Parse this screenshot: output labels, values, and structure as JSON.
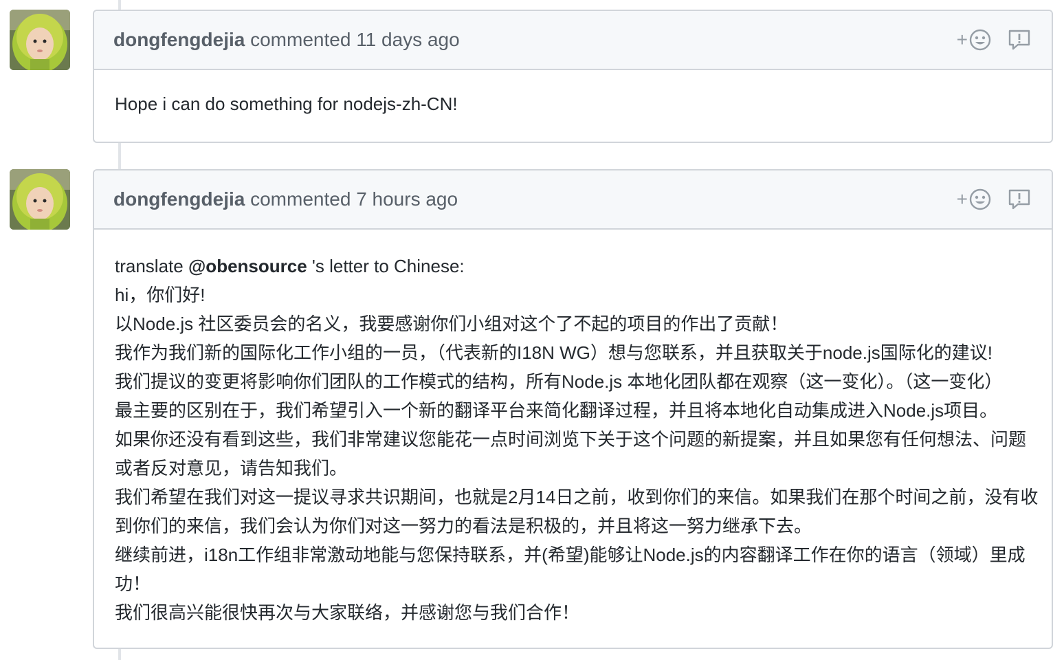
{
  "comments": [
    {
      "author": "dongfengdejia",
      "action": "commented",
      "timestamp": "11 days ago",
      "reaction_icon": "smiley-icon",
      "report_icon": "report-icon",
      "body_lines": [
        "Hope i can do something for nodejs-zh-CN!"
      ]
    },
    {
      "author": "dongfengdejia",
      "action": "commented",
      "timestamp": "7 hours ago",
      "reaction_icon": "smiley-icon",
      "report_icon": "report-icon",
      "first_line": {
        "prefix": "translate ",
        "mention": "@obensource",
        "suffix": " 's letter to Chinese:"
      },
      "body_lines": [
        "hi，你们好!",
        "以Node.js 社区委员会的名义，我要感谢你们小组对这个了不起的项目的作出了贡献！",
        "我作为我们新的国际化工作小组的一员，（代表新的I18N WG）想与您联系，并且获取关于node.js国际化的建议!",
        "我们提议的变更将影响你们团队的工作模式的结构，所有Node.js 本地化团队都在观察（这一变化）。（这一变化）",
        "最主要的区别在于，我们希望引入一个新的翻译平台来简化翻译过程，并且将本地化自动集成进入Node.js项目。",
        "如果你还没有看到这些，我们非常建议您能花一点时间浏览下关于这个问题的新提案，并且如果您有任何想法、问题",
        "或者反对意见，请告知我们。",
        "我们希望在我们对这一提议寻求共识期间，也就是2月14日之前，收到你们的来信。如果我们在那个时间之前，没有收",
        "到你们的来信，我们会认为你们对这一努力的看法是积极的，并且将这一努力继承下去。",
        "继续前进，i18n工作组非常激动地能与您保持联系，并(希望)能够让Node.js的内容翻译工作在你的语言（领域）里成",
        "功！",
        "我们很高兴能很快再次与大家联络，并感谢您与我们合作！"
      ]
    }
  ],
  "colors": {
    "header_bg": "#f6f8fa",
    "border": "#d1d5da",
    "muted_text": "#586069",
    "body_text": "#24292e",
    "timeline": "#e1e4e8"
  }
}
